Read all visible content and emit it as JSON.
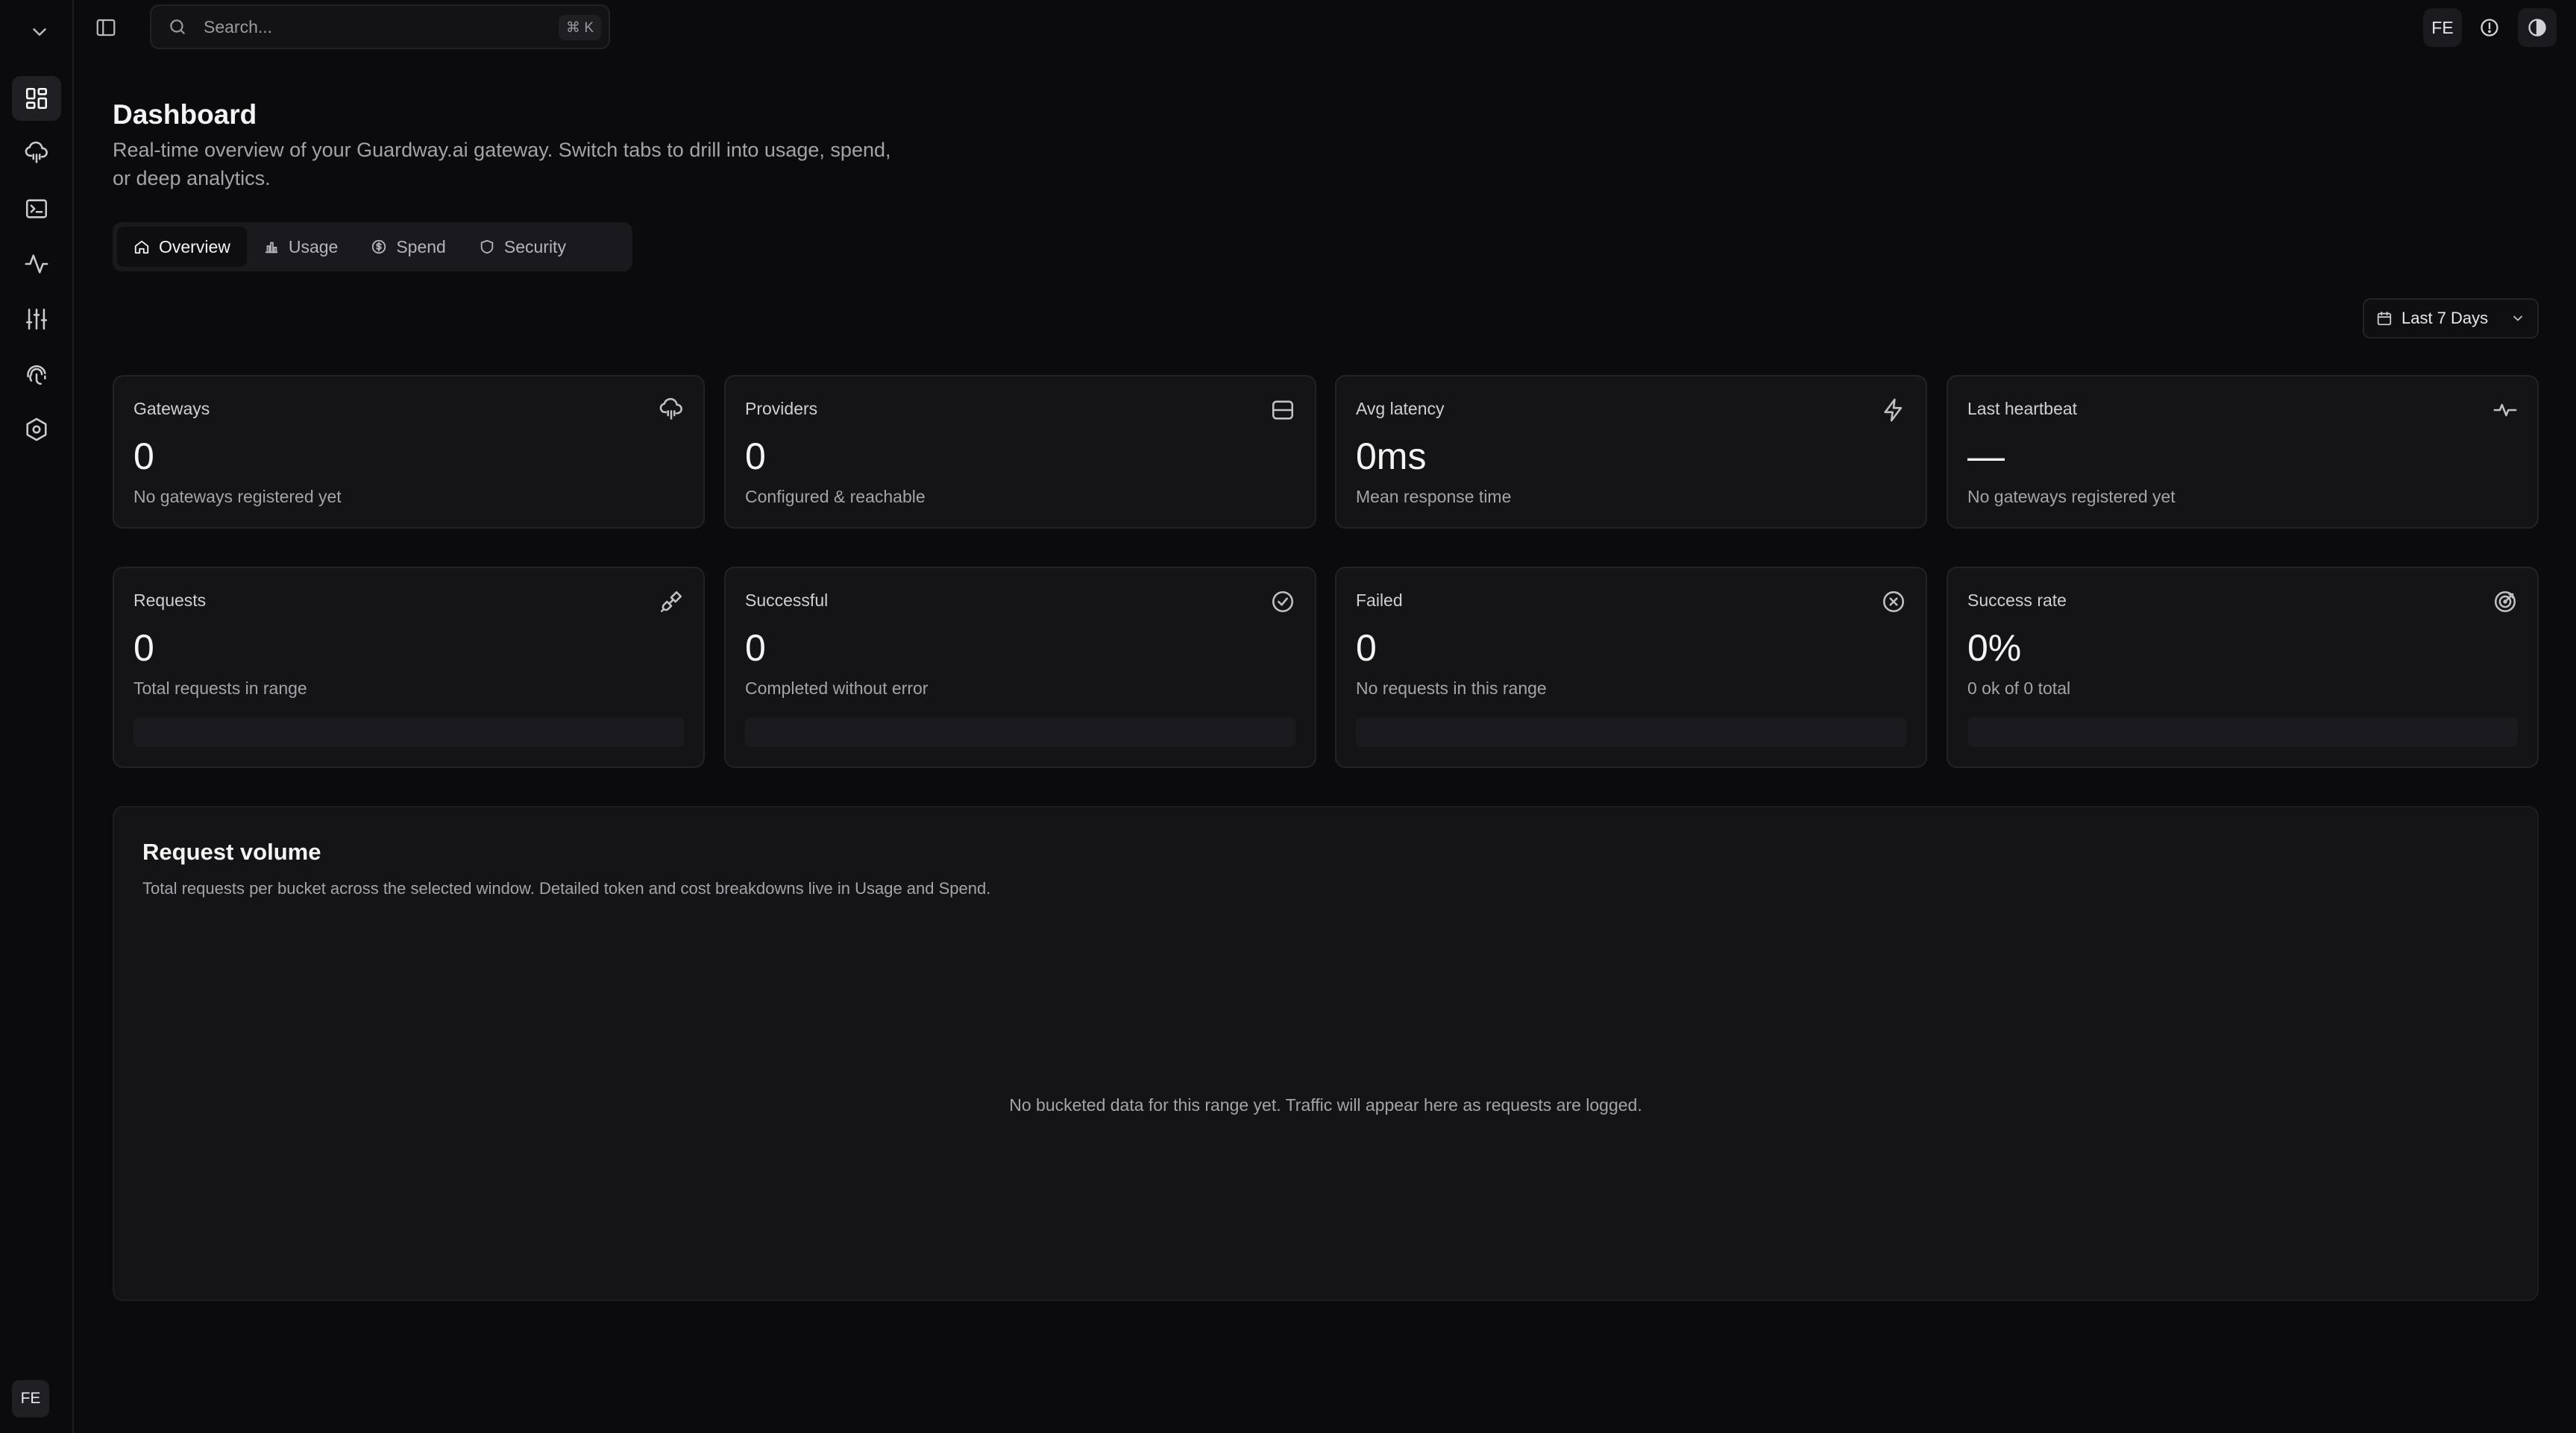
{
  "topbar": {
    "search_placeholder": "Search...",
    "search_shortcut": "⌘ K",
    "user_initials": "FE"
  },
  "rail": {
    "items": [
      {
        "icon": "dashboard-grid-icon",
        "active": true
      },
      {
        "icon": "cloud-network-icon"
      },
      {
        "icon": "terminal-icon"
      },
      {
        "icon": "activity-pulse-icon"
      },
      {
        "icon": "sliders-icon"
      },
      {
        "icon": "fingerprint-icon"
      },
      {
        "icon": "settings-hexagon-icon"
      }
    ],
    "user_initials": "FE"
  },
  "header": {
    "title": "Dashboard",
    "subtitle_line1": "Real-time overview of your Guardway.ai gateway. Switch tabs to drill into usage, spend,",
    "subtitle_line2": "or deep analytics."
  },
  "tabs": [
    {
      "label": "Overview",
      "icon": "home-icon",
      "active": true
    },
    {
      "label": "Usage",
      "icon": "bar-chart-icon"
    },
    {
      "label": "Spend",
      "icon": "dollar-circle-icon"
    },
    {
      "label": "Security",
      "icon": "shield-icon"
    }
  ],
  "date_range": {
    "label": "Last 7 Days"
  },
  "cards_row1": [
    {
      "label": "Gateways",
      "value": "0",
      "sub": "No gateways registered yet",
      "icon": "cloud-network-icon"
    },
    {
      "label": "Providers",
      "value": "0",
      "sub": "Configured & reachable",
      "icon": "server-icon"
    },
    {
      "label": "Avg latency",
      "value": "0ms",
      "sub": "Mean response time",
      "icon": "lightning-icon"
    },
    {
      "label": "Last heartbeat",
      "value": "—",
      "sub": "No gateways registered yet",
      "icon": "pulse-icon"
    }
  ],
  "cards_row2": [
    {
      "label": "Requests",
      "value": "0",
      "sub": "Total requests in range",
      "icon": "plug-icon"
    },
    {
      "label": "Successful",
      "value": "0",
      "sub": "Completed without error",
      "icon": "check-circle-icon"
    },
    {
      "label": "Failed",
      "value": "0",
      "sub": "No requests in this range",
      "icon": "x-circle-icon"
    },
    {
      "label": "Success rate",
      "value": "0%",
      "sub": "0 ok of 0 total",
      "icon": "target-icon"
    }
  ],
  "volume": {
    "title": "Request volume",
    "description": "Total requests per bucket across the selected window. Detailed token and cost breakdowns live in Usage and Spend.",
    "empty_message": "No bucketed data for this range yet. Traffic will appear here as requests are logged."
  }
}
